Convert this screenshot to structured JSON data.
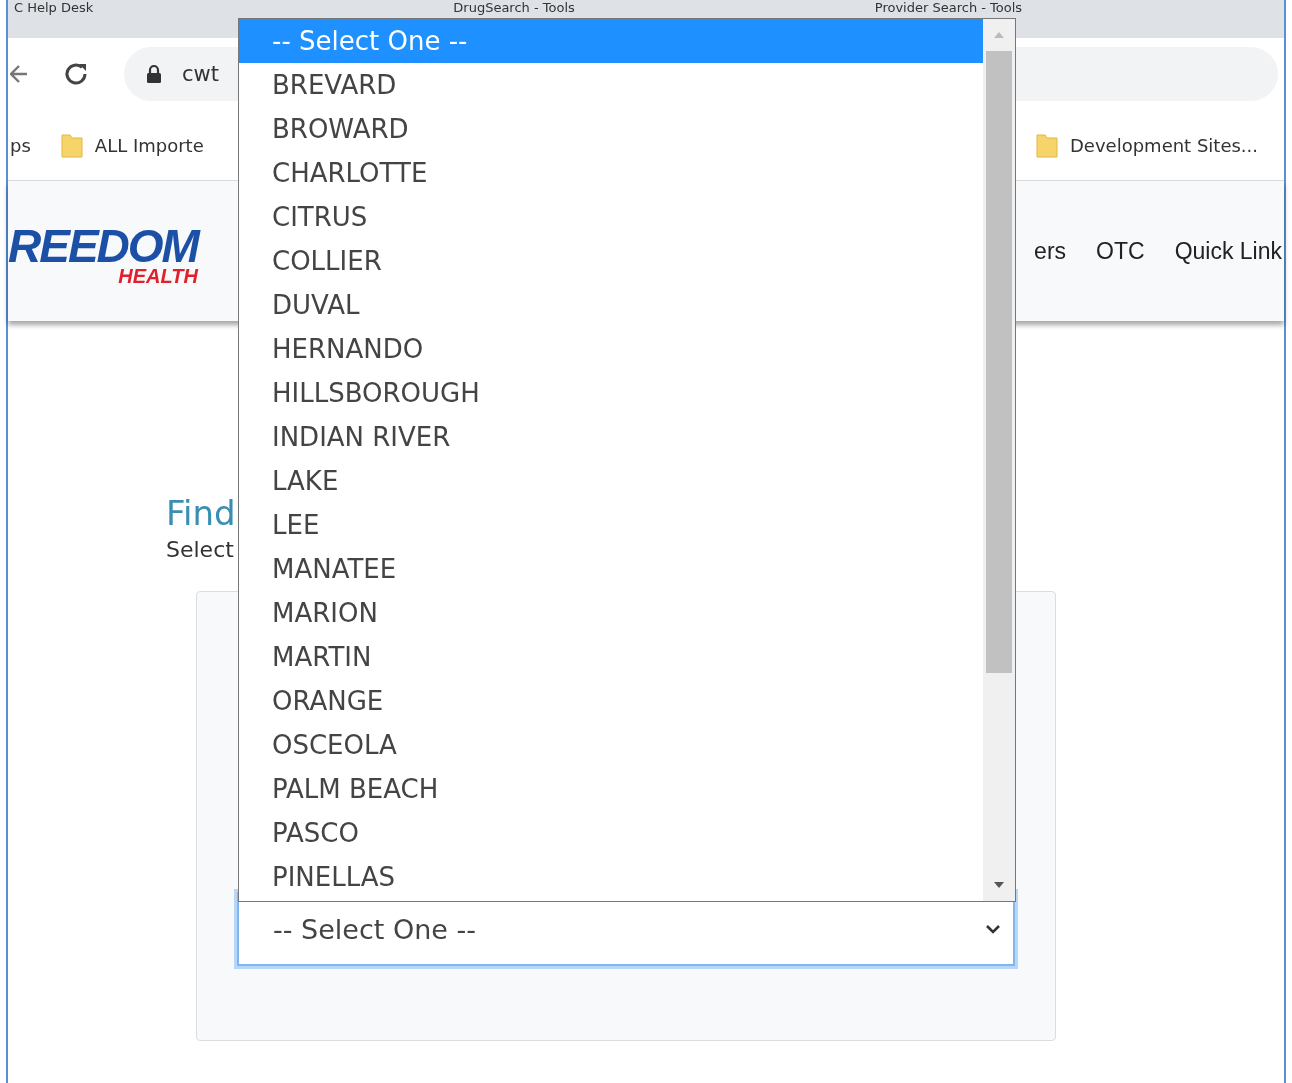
{
  "browser": {
    "tabs": [
      {
        "title": "C Help Desk"
      },
      {
        "title": "DrugSearch - Tools"
      },
      {
        "title": "Provider Search - Tools"
      }
    ],
    "address": "cwt",
    "bookmarks": [
      {
        "label": "ps",
        "kind": "link"
      },
      {
        "label": "ALL Importe",
        "kind": "folder"
      },
      {
        "label": "Development Sites...",
        "kind": "folder"
      }
    ]
  },
  "header": {
    "logo": {
      "word": "REEDOM",
      "sub": "HEALTH"
    },
    "nav": [
      "ers",
      "OTC",
      "Quick Link"
    ]
  },
  "page": {
    "heading": "Find",
    "subtext": "Select"
  },
  "county_select": {
    "value": "-- Select One --",
    "options": [
      {
        "label": "-- Select One --",
        "selected": true
      },
      {
        "label": "BREVARD",
        "selected": false
      },
      {
        "label": "BROWARD",
        "selected": false
      },
      {
        "label": "CHARLOTTE",
        "selected": false
      },
      {
        "label": "CITRUS",
        "selected": false
      },
      {
        "label": "COLLIER",
        "selected": false
      },
      {
        "label": "DUVAL",
        "selected": false
      },
      {
        "label": "HERNANDO",
        "selected": false
      },
      {
        "label": "HILLSBOROUGH",
        "selected": false
      },
      {
        "label": "INDIAN RIVER",
        "selected": false
      },
      {
        "label": "LAKE",
        "selected": false
      },
      {
        "label": "LEE",
        "selected": false
      },
      {
        "label": "MANATEE",
        "selected": false
      },
      {
        "label": "MARION",
        "selected": false
      },
      {
        "label": "MARTIN",
        "selected": false
      },
      {
        "label": "ORANGE",
        "selected": false
      },
      {
        "label": "OSCEOLA",
        "selected": false
      },
      {
        "label": "PALM BEACH",
        "selected": false
      },
      {
        "label": "PASCO",
        "selected": false
      },
      {
        "label": "PINELLAS",
        "selected": false
      }
    ]
  }
}
